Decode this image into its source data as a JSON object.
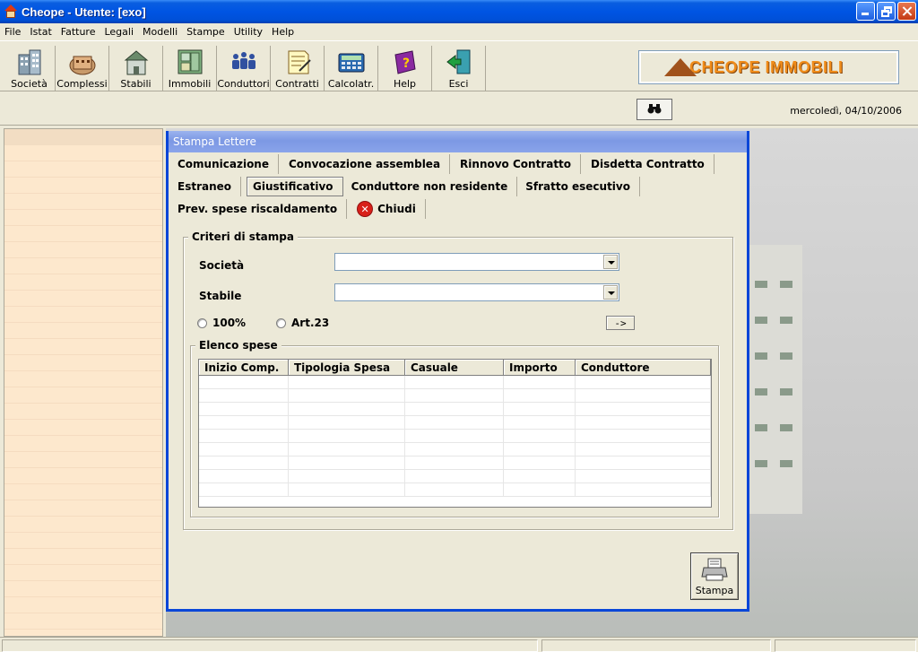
{
  "window": {
    "title": "Cheope - Utente: [exo]"
  },
  "menu": [
    "File",
    "Istat",
    "Fatture",
    "Legali",
    "Modelli",
    "Stampe",
    "Utility",
    "Help"
  ],
  "toolbar": {
    "buttons": [
      {
        "label": "Società",
        "icon": "building-icon"
      },
      {
        "label": "Complessi",
        "icon": "complex-icon"
      },
      {
        "label": "Stabili",
        "icon": "house-icon"
      },
      {
        "label": "Immobili",
        "icon": "plan-icon"
      },
      {
        "label": "Conduttori",
        "icon": "people-icon"
      },
      {
        "label": "Contratti",
        "icon": "contract-icon"
      },
      {
        "label": "Calcolatr.",
        "icon": "calculator-icon"
      },
      {
        "label": "Help",
        "icon": "help-book-icon"
      },
      {
        "label": "Esci",
        "icon": "exit-icon"
      }
    ],
    "logo_text": "CHEOPE IMMOBILI"
  },
  "status": {
    "date": "mercoledì, 04/10/2006"
  },
  "dialog": {
    "title": "Stampa Lettere",
    "tabs_row1": [
      "Comunicazione",
      "Convocazione assemblea",
      "Rinnovo Contratto",
      "Disdetta Contratto"
    ],
    "tabs_row2": [
      "Estraneo",
      "Giustificativo",
      "Conduttore non residente",
      "Sfratto esecutivo"
    ],
    "tabs_row3": [
      "Prev. spese riscaldamento",
      "Chiudi"
    ],
    "active_tab": "Giustificativo",
    "criteria": {
      "label": "Criteri di stampa",
      "societa_label": "Società",
      "societa_value": "",
      "stabile_label": "Stabile",
      "stabile_value": "",
      "radio1": "100%",
      "radio2": "Art.23",
      "arrow_button": "->"
    },
    "expenses": {
      "label": "Elenco spese",
      "columns": [
        "Inizio Comp.",
        "Tipologia Spesa",
        "Casuale",
        "Importo",
        "Conduttore"
      ]
    },
    "print_button": "Stampa"
  }
}
